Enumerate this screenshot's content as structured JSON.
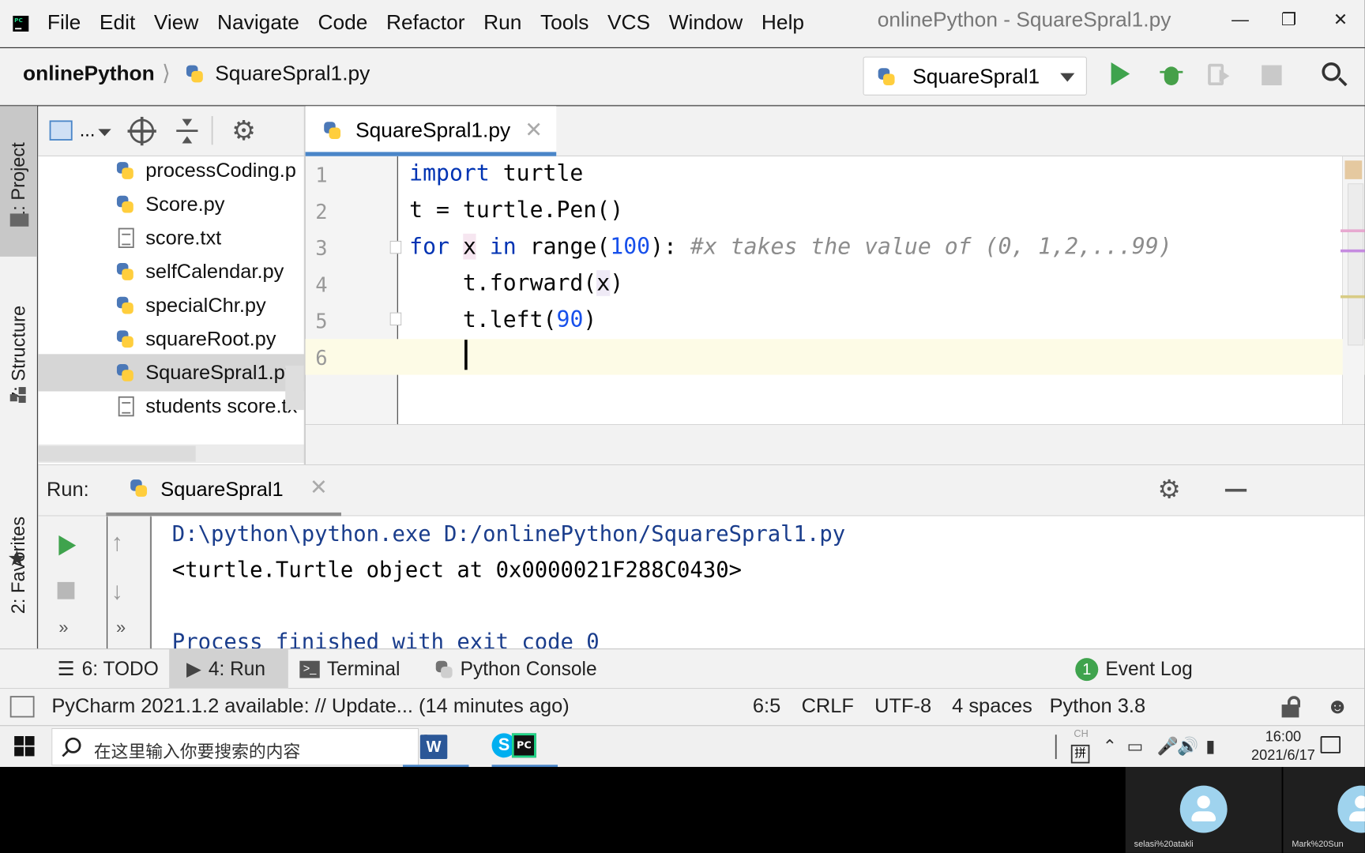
{
  "window": {
    "title": "onlinePython - SquareSpral1.py",
    "menu": [
      "File",
      "Edit",
      "View",
      "Navigate",
      "Code",
      "Refactor",
      "Run",
      "Tools",
      "VCS",
      "Window",
      "Help"
    ]
  },
  "navbar": {
    "project": "onlinePython",
    "file": "SquareSpral1.py",
    "run_config": "SquareSpral1"
  },
  "left_tabs": {
    "project": "1: Project",
    "structure": "7: Structure",
    "favorites": "2: Favorites"
  },
  "project_panel": {
    "view_label": "...",
    "files": [
      {
        "name": "processCoding.p",
        "type": "python"
      },
      {
        "name": "Score.py",
        "type": "python"
      },
      {
        "name": "score.txt",
        "type": "text"
      },
      {
        "name": "selfCalendar.py",
        "type": "python"
      },
      {
        "name": "specialChr.py",
        "type": "python"
      },
      {
        "name": "squareRoot.py",
        "type": "python"
      },
      {
        "name": "SquareSpral1.py",
        "type": "python",
        "selected": true
      },
      {
        "name": "students score.tx",
        "type": "text"
      }
    ]
  },
  "editor": {
    "tab": "SquareSpral1.py",
    "lines": [
      "1",
      "2",
      "3",
      "4",
      "5",
      "6"
    ],
    "code": {
      "l1_kw": "import",
      "l1_rest": " turtle",
      "l2": "t = turtle.Pen()",
      "l3_for": "for",
      "l3_var": "x",
      "l3_in": "in",
      "l3_range": "range(",
      "l3_num": "100",
      "l3_close": "):",
      "l3_comment": "#x takes the value of (0, 1,2,...99)",
      "l4_pre": "    t.forward(",
      "l4_arg": "x",
      "l4_post": ")",
      "l5_pre": "    t.left(",
      "l5_num": "90",
      "l5_post": ")"
    }
  },
  "run_panel": {
    "title": "Run:",
    "tab": "SquareSpral1",
    "output": [
      "D:\\python\\python.exe D:/onlinePython/SquareSpral1.py",
      "<turtle.Turtle object at 0x0000021F288C0430>",
      "",
      "Process finished with exit code 0"
    ]
  },
  "bottom_tabs": {
    "todo": "6: TODO",
    "run": "4: Run",
    "terminal": "Terminal",
    "python_console": "Python Console",
    "event_log": "Event Log",
    "event_count": "1"
  },
  "status": {
    "message": "PyCharm 2021.1.2 available: // Update... (14 minutes ago)",
    "position": "6:5",
    "line_sep": "CRLF",
    "encoding": "UTF-8",
    "indent": "4 spaces",
    "interpreter": "Python 3.8"
  },
  "taskbar": {
    "search_placeholder": "在这里输入你要搜索的内容",
    "apps": [
      "word-icon",
      "skype-icon",
      "pycharm-icon"
    ],
    "ime_top": "CH",
    "ime": "拼",
    "time": "16:00",
    "date": "2021/6/17"
  },
  "call": {
    "participants": [
      "selasi%20atakli",
      "Mark%20Sun"
    ]
  },
  "colors": {
    "keyword": "#0033b3",
    "number": "#1750eb",
    "comment": "#8c8c8c",
    "run_green": "#3fa34d",
    "tab_accent": "#4a86c8"
  }
}
